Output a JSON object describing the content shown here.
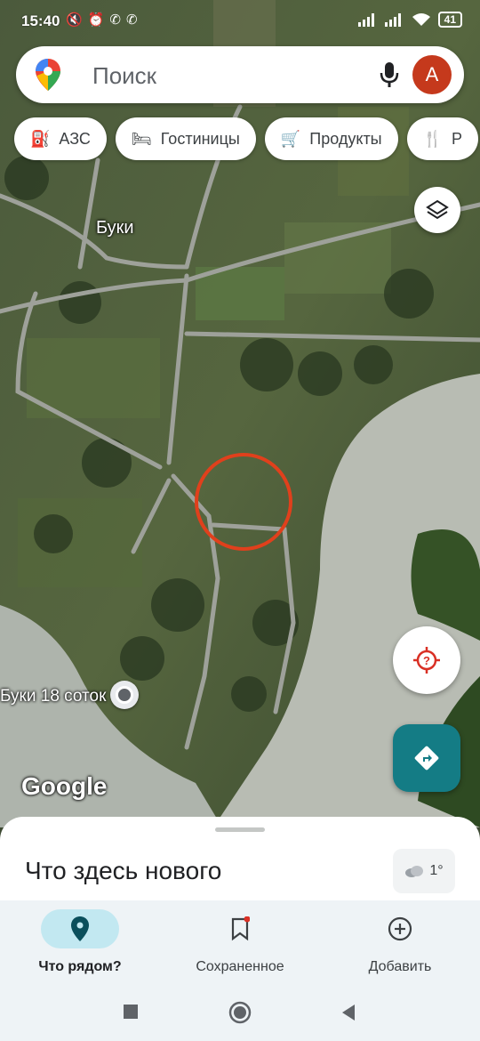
{
  "status_bar": {
    "time": "15:40",
    "battery": "41",
    "left_icons": [
      "mute-icon",
      "alarm-icon",
      "viber-icon",
      "viber-icon"
    ],
    "right_icons": [
      "signal-icon",
      "signal-icon",
      "wifi-icon"
    ]
  },
  "search": {
    "placeholder": "Поиск",
    "avatar_letter": "A"
  },
  "chips": [
    {
      "label": "АЗС",
      "icon": "gas-station-icon"
    },
    {
      "label": "Гостиницы",
      "icon": "bed-icon"
    },
    {
      "label": "Продукты",
      "icon": "cart-icon"
    },
    {
      "label": "Р",
      "icon": "restaurant-icon"
    }
  ],
  "map": {
    "village_label": "Буки",
    "place_label": "Буки 18 соток",
    "watermark": "Google"
  },
  "sheet": {
    "title": "Что здесь нового",
    "weather_temp": "1°"
  },
  "nav": [
    {
      "label": "Что рядом?",
      "icon": "location-pin-icon",
      "active": true
    },
    {
      "label": "Сохраненное",
      "icon": "bookmark-icon",
      "active": false
    },
    {
      "label": "Добавить",
      "icon": "add-circle-icon",
      "active": false
    }
  ],
  "colors": {
    "accent_teal": "#147c85",
    "avatar": "#c5391c",
    "active_pill": "#c2e8f1",
    "highlight_circle": "#e0401c"
  }
}
